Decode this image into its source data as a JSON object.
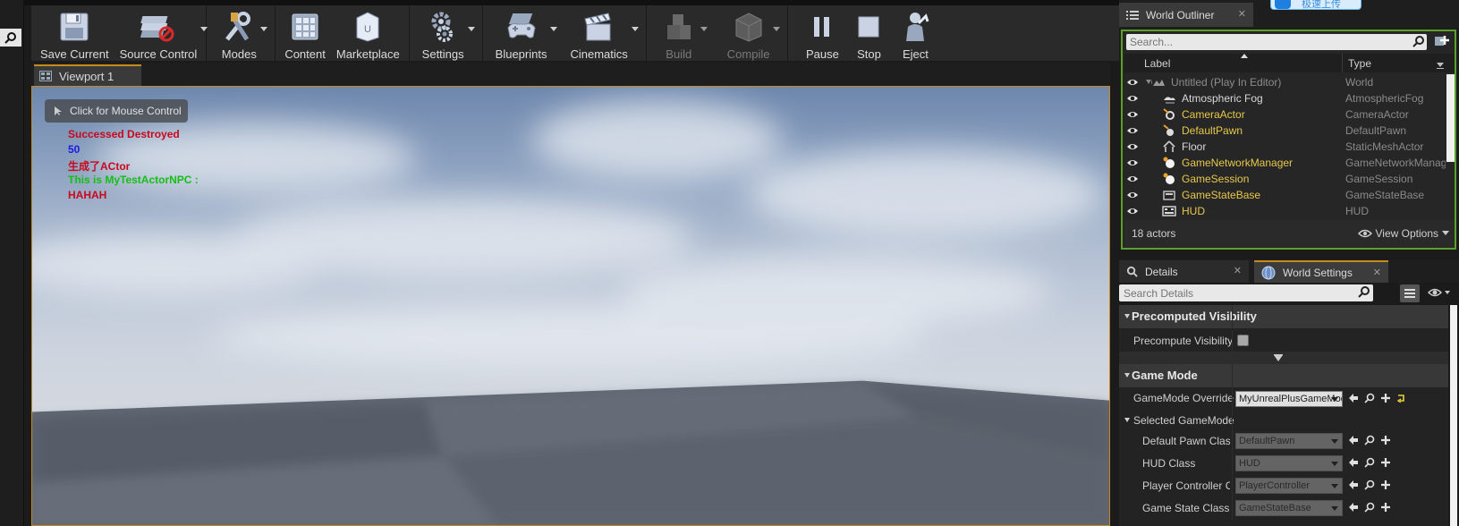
{
  "toolbar": {
    "buttons": [
      {
        "label": "Save Current"
      },
      {
        "label": "Source Control"
      },
      {
        "label": "Modes"
      },
      {
        "label": "Content"
      },
      {
        "label": "Marketplace"
      },
      {
        "label": "Settings"
      },
      {
        "label": "Blueprints"
      },
      {
        "label": "Cinematics"
      },
      {
        "label": "Build"
      },
      {
        "label": "Compile"
      },
      {
        "label": "Pause"
      },
      {
        "label": "Stop"
      },
      {
        "label": "Eject"
      }
    ]
  },
  "viewport": {
    "tab_label": "Viewport 1",
    "mouse_control": "Click for Mouse Control",
    "debug_messages": [
      {
        "text": "Successed Destroyed",
        "color": "#c8081d"
      },
      {
        "text": "50",
        "color": "#1b1be0"
      },
      {
        "text": "生成了ACtor",
        "color": "#c8081d"
      },
      {
        "text": "This is MyTestActorNPC :",
        "color": "#13c013"
      },
      {
        "text": "HAHAH",
        "color": "#c8081d"
      }
    ]
  },
  "upload_button": {
    "label": "极速上传"
  },
  "outliner": {
    "tab_label": "World Outliner",
    "search_placeholder": "Search...",
    "col_label": "Label",
    "col_type": "Type",
    "rows": [
      {
        "name": "Untitled (Play In Editor)",
        "type": "World",
        "style": "dim",
        "icon": "world-icon"
      },
      {
        "name": "Atmospheric Fog",
        "type": "AtmosphericFog",
        "style": "white",
        "icon": "fog-icon"
      },
      {
        "name": "CameraActor",
        "type": "CameraActor",
        "style": "yellow",
        "icon": "camera-icon"
      },
      {
        "name": "DefaultPawn",
        "type": "DefaultPawn",
        "style": "yellow",
        "icon": "pawn-icon"
      },
      {
        "name": "Floor",
        "type": "StaticMeshActor",
        "style": "white",
        "icon": "mesh-icon"
      },
      {
        "name": "GameNetworkManager",
        "type": "GameNetworkManager",
        "style": "yellow",
        "icon": "actor-sphere-icon"
      },
      {
        "name": "GameSession",
        "type": "GameSession",
        "style": "yellow",
        "icon": "actor-sphere-icon"
      },
      {
        "name": "GameStateBase",
        "type": "GameStateBase",
        "style": "yellow",
        "icon": "gamestate-icon"
      },
      {
        "name": "HUD",
        "type": "HUD",
        "style": "yellow",
        "icon": "hud-icon"
      }
    ],
    "actor_count": "18 actors",
    "view_options": "View Options"
  },
  "details": {
    "tab_details": "Details",
    "tab_world_settings": "World Settings",
    "search_placeholder": "Search Details",
    "cat_precomputed": "Precomputed Visibility",
    "prop_precompute": "Precompute Visibility",
    "cat_gamemode": "Game Mode",
    "prop_gamemode_override": "GameMode Override",
    "gamemode_override_value": "MyUnrealPlusGameMode",
    "sub_selected": "Selected GameMode",
    "props": [
      {
        "label": "Default Pawn Class",
        "value": "DefaultPawn"
      },
      {
        "label": "HUD Class",
        "value": "HUD"
      },
      {
        "label": "Player Controller Class",
        "value": "PlayerController"
      },
      {
        "label": "Game State Class",
        "value": "GameStateBase"
      }
    ]
  },
  "colors": {
    "accent": "#c78a1d",
    "outliner_border": "#5aa02a",
    "yellow_text": "#e8c84a",
    "white_text": "#d8d8d8"
  }
}
